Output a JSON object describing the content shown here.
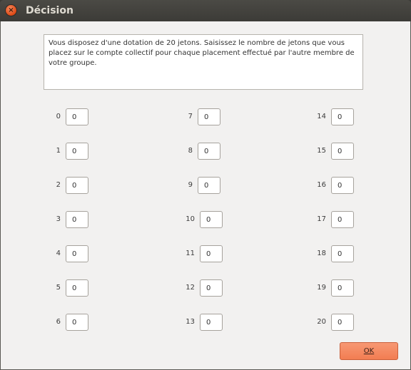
{
  "window": {
    "title": "Décision",
    "close_icon": "close-icon"
  },
  "message": "Vous disposez d'une dotation de 20 jetons. Saisissez le nombre de jetons que vous placez sur le compte collectif pour chaque placement effectué par l'autre membre de votre groupe.",
  "fields": [
    {
      "label": "0",
      "value": "0"
    },
    {
      "label": "1",
      "value": "0"
    },
    {
      "label": "2",
      "value": "0"
    },
    {
      "label": "3",
      "value": "0"
    },
    {
      "label": "4",
      "value": "0"
    },
    {
      "label": "5",
      "value": "0"
    },
    {
      "label": "6",
      "value": "0"
    },
    {
      "label": "7",
      "value": "0"
    },
    {
      "label": "8",
      "value": "0"
    },
    {
      "label": "9",
      "value": "0"
    },
    {
      "label": "10",
      "value": "0"
    },
    {
      "label": "11",
      "value": "0"
    },
    {
      "label": "12",
      "value": "0"
    },
    {
      "label": "13",
      "value": "0"
    },
    {
      "label": "14",
      "value": "0"
    },
    {
      "label": "15",
      "value": "0"
    },
    {
      "label": "16",
      "value": "0"
    },
    {
      "label": "17",
      "value": "0"
    },
    {
      "label": "18",
      "value": "0"
    },
    {
      "label": "19",
      "value": "0"
    },
    {
      "label": "20",
      "value": "0"
    }
  ],
  "ok_button": {
    "label": "OK",
    "color": "#f27d52"
  }
}
